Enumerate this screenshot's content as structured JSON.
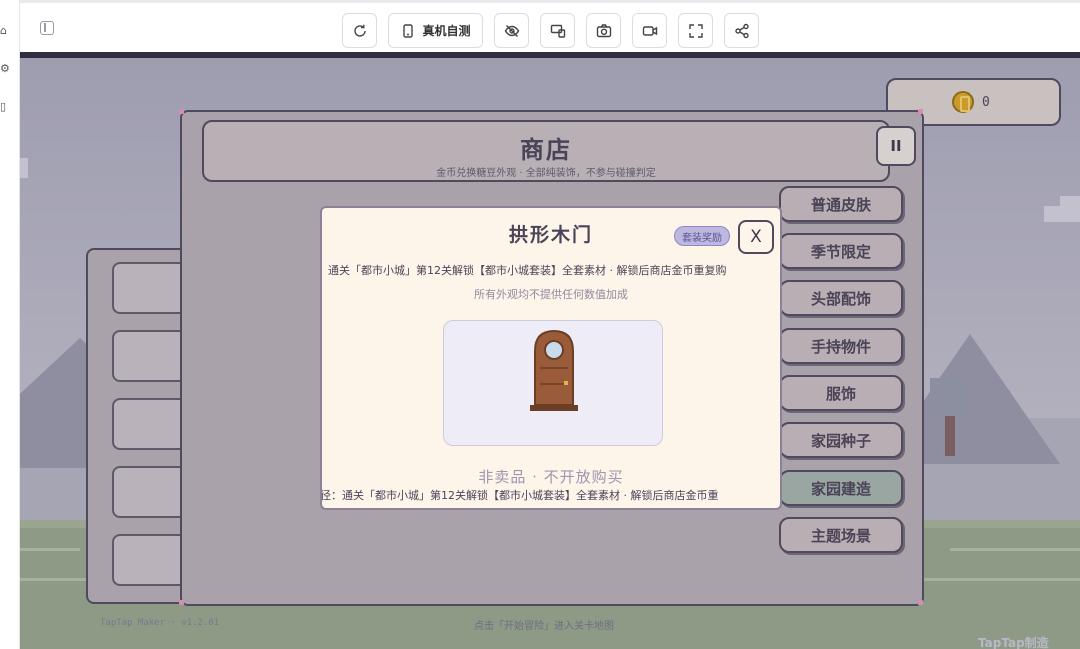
{
  "toolbar": {
    "device_test_label": "真机自测"
  },
  "left_strip_icons": [
    "home-icon",
    "settings-icon",
    "page-icon"
  ],
  "game": {
    "coin_count": "0",
    "version": "TapTap Maker · v1.2.01",
    "hint": "点击「开始冒险」进入关卡地图",
    "brand": "TapTap制造"
  },
  "shop": {
    "title": "商店",
    "subtitle": "金币兑换糖豆外观 · 全部纯装饰，不参与碰撞判定",
    "close_label": "ⅠⅠ",
    "categories": [
      {
        "label": "普通皮肤",
        "active": false
      },
      {
        "label": "季节限定",
        "active": false
      },
      {
        "label": "头部配饰",
        "active": false
      },
      {
        "label": "手持物件",
        "active": false
      },
      {
        "label": "服饰",
        "active": false
      },
      {
        "label": "家园种子",
        "active": false
      },
      {
        "label": "家园建造",
        "active": true
      },
      {
        "label": "主题场景",
        "active": false
      }
    ]
  },
  "modal": {
    "title": "拱形木门",
    "badge": "套装奖励",
    "close_label": "X",
    "unlock_text": "通关「都市小城」第12关解锁【都市小城套装】全套素材 · 解锁后商店金币重复购",
    "note": "所有外观均不提供任何数值加成",
    "status": "非卖品 · 不开放购买",
    "path_text": "径：通关「都市小城」第12关解锁【都市小城套装】全套素材 · 解锁后商店金币重"
  },
  "colors": {
    "accent_badge": "#bdb8e0",
    "active_category": "#9aa6a2",
    "coin": "#c99b2b",
    "door": "#9a5b3a"
  }
}
